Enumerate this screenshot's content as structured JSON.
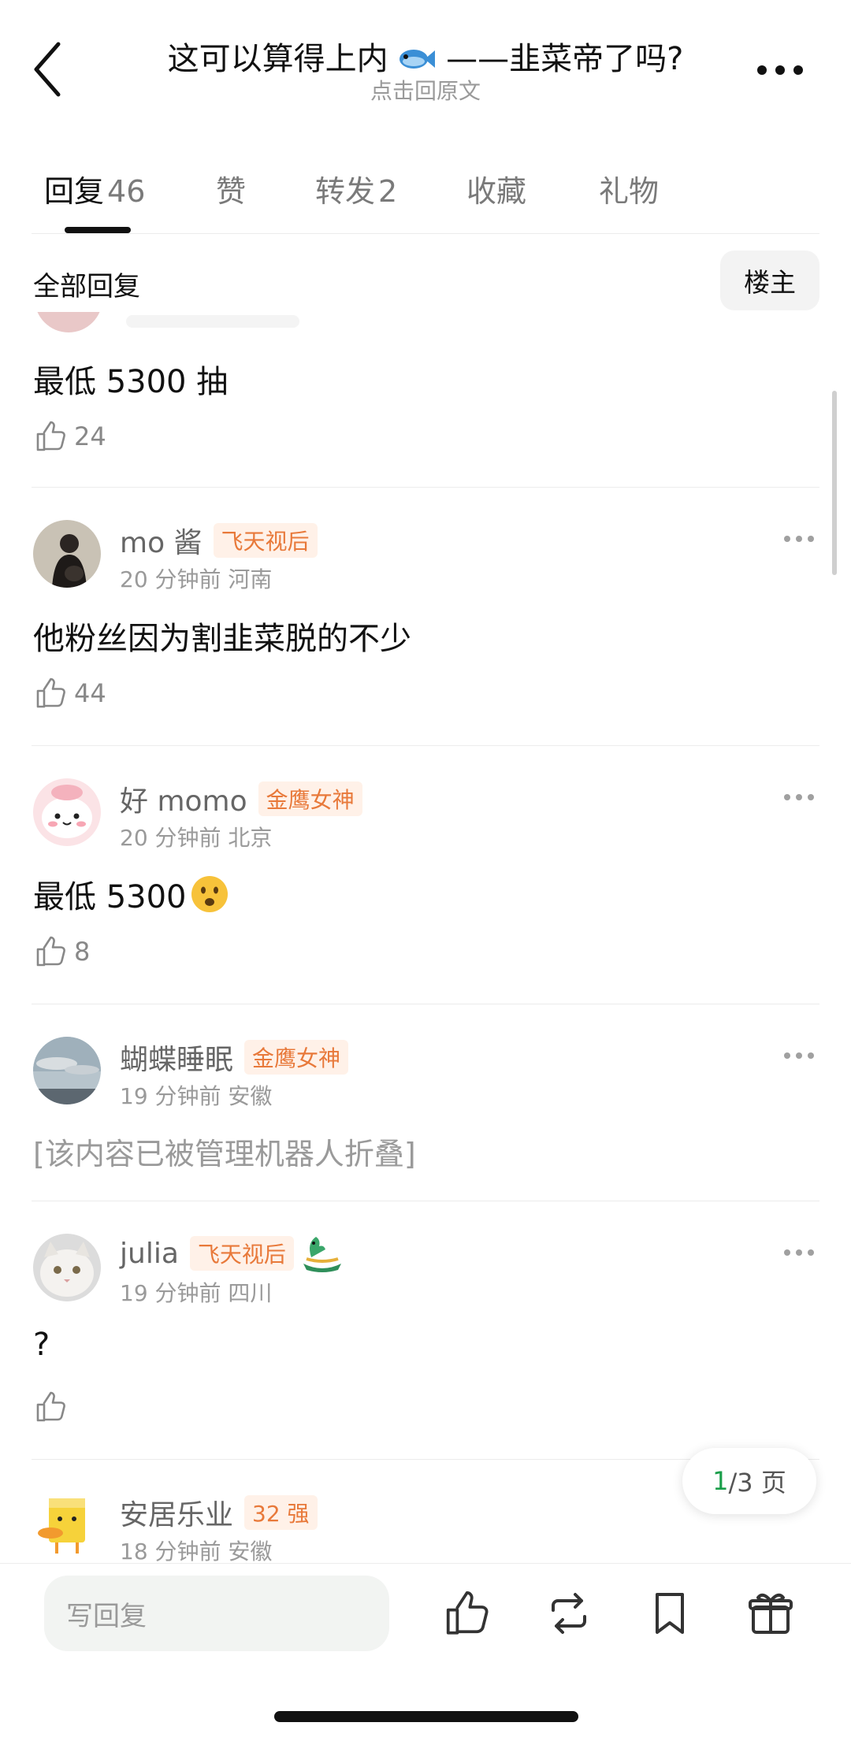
{
  "header": {
    "title": "这可以算得上内",
    "title_suffix": "——韭菜帝了吗?",
    "title_icon": "fish-emoji",
    "subtitle": "点击回原文"
  },
  "tabs": [
    {
      "label": "回复",
      "count": "46",
      "active": true
    },
    {
      "label": "赞",
      "count": ""
    },
    {
      "label": "转发",
      "count": "2"
    },
    {
      "label": "收藏",
      "count": ""
    },
    {
      "label": "礼物",
      "count": ""
    }
  ],
  "filter": {
    "all_label": "全部回复",
    "op_label": "楼主"
  },
  "comments": [
    {
      "text": "最低 5300 抽",
      "likes": "24"
    },
    {
      "user": "mo 酱",
      "badge": "飞天视后",
      "time": "20 分钟前 河南",
      "text": "他粉丝因为割韭菜脱的不少",
      "likes": "44"
    },
    {
      "user": "好 momo",
      "badge": "金鹰女神",
      "time": "20 分钟前 北京",
      "text": "最低 5300",
      "text_emoji": "frowning-face-emoji",
      "likes": "8"
    },
    {
      "user": "蝴蝶睡眠",
      "badge": "金鹰女神",
      "time": "19 分钟前 安徽",
      "text": "[该内容已被管理机器人折叠]"
    },
    {
      "user": "julia",
      "badge": "飞天视后",
      "badge_extra_icon": "dragon-boat-icon",
      "time": "19 分钟前 四川",
      "text": "?",
      "likes": ""
    },
    {
      "user": "安居乐业",
      "badge": "32 强",
      "time": "18 分钟前 安徽"
    }
  ],
  "pager": {
    "current": "1",
    "total": "/3 页"
  },
  "bottom": {
    "reply_placeholder": "写回复"
  },
  "colors": {
    "badge_bg": "#fff1e8",
    "badge_text": "#e8793a",
    "pager_current": "#1a9e4a"
  }
}
